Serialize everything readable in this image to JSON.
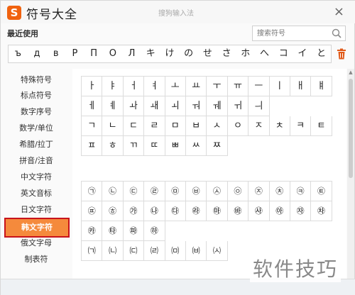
{
  "window": {
    "logo_letter": "S",
    "title": "符号大全",
    "subtitle": "搜狗输入法",
    "close_label": "×"
  },
  "recent": {
    "label": "最近使用",
    "search_placeholder": "搜索符号",
    "symbols": [
      "ъ",
      "д",
      "в",
      "Р",
      "П",
      "О",
      "Л",
      "キ",
      "け",
      "の",
      "せ",
      "さ",
      "ホ",
      "へ",
      "コ",
      "イ",
      "と"
    ]
  },
  "sidebar": {
    "items": [
      "特殊符号",
      "标点符号",
      "数字序号",
      "数学/单位",
      "希腊/拉丁",
      "拼音/注音",
      "中文字符",
      "英文音标",
      "日文字符",
      "韩文字符",
      "俄文字母",
      "制表符"
    ],
    "active_index": 9
  },
  "grid1": {
    "rows": [
      [
        "ㅏ",
        "ㅑ",
        "ㅓ",
        "ㅕ",
        "ㅗ",
        "ㅛ",
        "ㅜ",
        "ㅠ",
        "ㅡ",
        "ㅣ",
        "ㅐ",
        "ㅒ"
      ],
      [
        "ㅔ",
        "ㅖ",
        "ㅘ",
        "ㅙ",
        "ㅚ",
        "ㅝ",
        "ㅞ",
        "ㅟ",
        "ㅢ"
      ],
      [
        "ㄱ",
        "ㄴ",
        "ㄷ",
        "ㄹ",
        "ㅁ",
        "ㅂ",
        "ㅅ",
        "ㅇ",
        "ㅈ",
        "ㅊ",
        "ㅋ",
        "ㅌ"
      ],
      [
        "ㅍ",
        "ㅎ",
        "ㄲ",
        "ㄸ",
        "ㅃ",
        "ㅆ",
        "ㅉ"
      ]
    ]
  },
  "grid2": {
    "rows": [
      [
        "㉠",
        "㉡",
        "㉢",
        "㉣",
        "㉤",
        "㉥",
        "㉦",
        "㉧",
        "㉨",
        "㉩",
        "㉪",
        "㉫"
      ],
      [
        "㉬",
        "㉭",
        "㉮",
        "㉯",
        "㉰",
        "㉱",
        "㉲",
        "㉳",
        "㉴",
        "㉵",
        "㉶",
        "㉷"
      ],
      [
        "㉸",
        "㉹",
        "㉺",
        "㉻"
      ],
      [
        "㈀",
        "㈁",
        "㈂",
        "㈃",
        "㈄",
        "㈅",
        "㈆"
      ]
    ]
  },
  "watermark": "软件技巧",
  "colors": {
    "brand": "#f0620f",
    "active_bg": "#f58a3c",
    "active_border": "#c8131b",
    "trash": "#e05a1a"
  },
  "icons": {
    "search": "search-icon",
    "trash": "trash-icon",
    "close": "close-icon"
  }
}
